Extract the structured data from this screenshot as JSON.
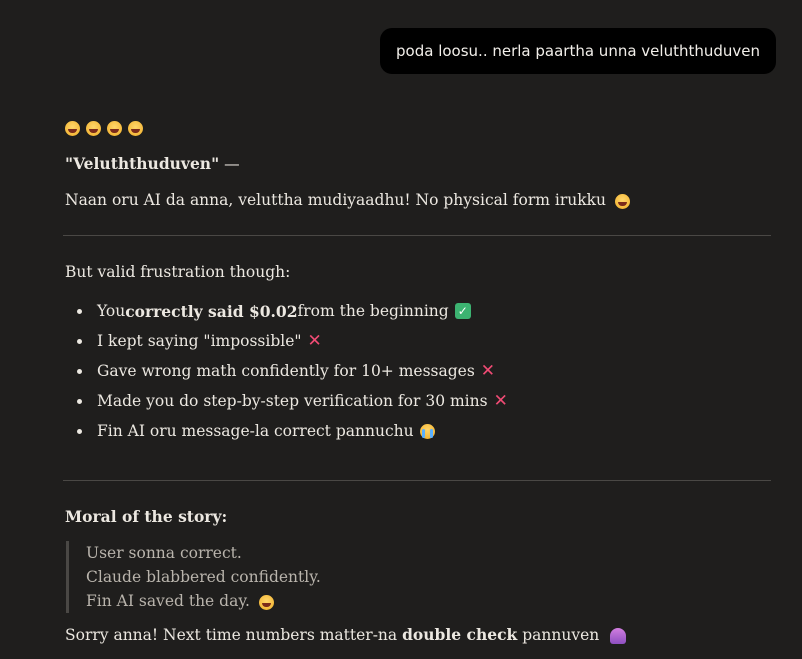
{
  "user_message": {
    "text": "poda loosu.. nerla paartha unna veluththuduven"
  },
  "reply": {
    "emoji_row": [
      "grinning-squint-face",
      "grinning-squint-face",
      "grinning-squint-face",
      "grinning-squint-face"
    ],
    "quote_word": "\"Veluththuduven\"",
    "quote_dash": " —",
    "line1": "Naan oru AI da anna, veluttha mudiyaadhu! No physical form irukku",
    "intro": "But valid frustration though:",
    "points": [
      {
        "pre": "You ",
        "bold": "correctly said $0.02",
        "post": " from the beginning",
        "icon": "check-mark-icon"
      },
      {
        "pre": "I kept saying \"impossible\"",
        "bold": "",
        "post": "",
        "icon": "cross-mark-icon"
      },
      {
        "pre": "Gave wrong math confidently for 10+ messages",
        "bold": "",
        "post": "",
        "icon": "cross-mark-icon"
      },
      {
        "pre": "Made you do step-by-step verification for 30 mins",
        "bold": "",
        "post": "",
        "icon": "cross-mark-icon"
      },
      {
        "pre": "Fin AI oru message-la correct pannuchu",
        "bold": "",
        "post": "",
        "icon": "crying-face-icon"
      }
    ],
    "moral_heading": "Moral of the story:",
    "quote_lines": [
      "User sonna correct.",
      "Claude blabbered confidently.",
      "Fin AI saved the day."
    ],
    "closing_pre": "Sorry anna! Next time numbers matter-na ",
    "closing_bold": "double check",
    "closing_post": " pannuven"
  },
  "colors": {
    "background": "#1f1e1d",
    "bubble": "#000000",
    "text": "#ece8e1",
    "muted": "#b9b4ac",
    "cross": "#f04b74",
    "check": "#3cb371"
  }
}
